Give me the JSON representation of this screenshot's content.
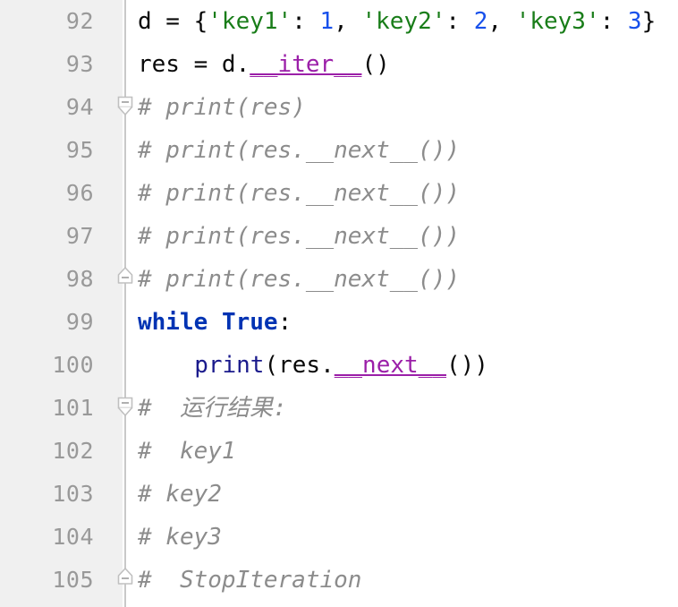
{
  "editor": {
    "language": "python",
    "theme": "light",
    "gutter_bg": "#f0f0f0",
    "code_bg": "#ffffff",
    "line_number_color": "#999999",
    "fold_rail_color": "#c9c9c9",
    "first_visible_line": 92,
    "last_visible_line": 105,
    "line_height_px": 48
  },
  "colors": {
    "plain": "#080808",
    "string": "#197d19",
    "number": "#1750eb",
    "keyword": "#0033b3",
    "builtin": "#1a1a8c",
    "dunder": "#9b1fa8",
    "comment": "#8c8c8c"
  },
  "lines": [
    {
      "number": "92",
      "fold": "none",
      "indent": 0,
      "tokens": [
        {
          "t": "d = {",
          "c": "plain"
        },
        {
          "t": "'key1'",
          "c": "string"
        },
        {
          "t": ": ",
          "c": "plain"
        },
        {
          "t": "1",
          "c": "number"
        },
        {
          "t": ", ",
          "c": "plain"
        },
        {
          "t": "'key2'",
          "c": "string"
        },
        {
          "t": ": ",
          "c": "plain"
        },
        {
          "t": "2",
          "c": "number"
        },
        {
          "t": ", ",
          "c": "plain"
        },
        {
          "t": "'key3'",
          "c": "string"
        },
        {
          "t": ": ",
          "c": "plain"
        },
        {
          "t": "3",
          "c": "number"
        },
        {
          "t": "}",
          "c": "plain"
        }
      ]
    },
    {
      "number": "93",
      "fold": "none",
      "indent": 0,
      "tokens": [
        {
          "t": "res = d.",
          "c": "plain"
        },
        {
          "t": "__iter__",
          "c": "dunder"
        },
        {
          "t": "()",
          "c": "plain"
        }
      ]
    },
    {
      "number": "94",
      "fold": "start",
      "indent": 0,
      "tokens": [
        {
          "t": "# print(res)",
          "c": "comment"
        }
      ]
    },
    {
      "number": "95",
      "fold": "none",
      "indent": 0,
      "tokens": [
        {
          "t": "# print(res.__next__())",
          "c": "comment"
        }
      ]
    },
    {
      "number": "96",
      "fold": "none",
      "indent": 0,
      "tokens": [
        {
          "t": "# print(res.__next__())",
          "c": "comment"
        }
      ]
    },
    {
      "number": "97",
      "fold": "none",
      "indent": 0,
      "tokens": [
        {
          "t": "# print(res.__next__())",
          "c": "comment"
        }
      ]
    },
    {
      "number": "98",
      "fold": "end",
      "indent": 0,
      "tokens": [
        {
          "t": "# print(res.__next__())",
          "c": "comment"
        }
      ]
    },
    {
      "number": "99",
      "fold": "none",
      "indent": 0,
      "tokens": [
        {
          "t": "while",
          "c": "keyword"
        },
        {
          "t": " ",
          "c": "plain"
        },
        {
          "t": "True",
          "c": "keyword"
        },
        {
          "t": ":",
          "c": "plain"
        }
      ]
    },
    {
      "number": "100",
      "fold": "none",
      "indent": 4,
      "tokens": [
        {
          "t": "print",
          "c": "builtin"
        },
        {
          "t": "(res.",
          "c": "plain"
        },
        {
          "t": "__next__",
          "c": "dunder"
        },
        {
          "t": "())",
          "c": "plain"
        }
      ]
    },
    {
      "number": "101",
      "fold": "start",
      "indent": 0,
      "tokens": [
        {
          "t": "#  运行结果:",
          "c": "comment"
        }
      ]
    },
    {
      "number": "102",
      "fold": "none",
      "indent": 0,
      "tokens": [
        {
          "t": "#  key1",
          "c": "comment"
        }
      ]
    },
    {
      "number": "103",
      "fold": "none",
      "indent": 0,
      "tokens": [
        {
          "t": "# key2",
          "c": "comment"
        }
      ]
    },
    {
      "number": "104",
      "fold": "none",
      "indent": 0,
      "tokens": [
        {
          "t": "# key3",
          "c": "comment"
        }
      ]
    },
    {
      "number": "105",
      "fold": "end",
      "indent": 0,
      "tokens": [
        {
          "t": "#  StopIteration",
          "c": "comment"
        }
      ]
    }
  ]
}
